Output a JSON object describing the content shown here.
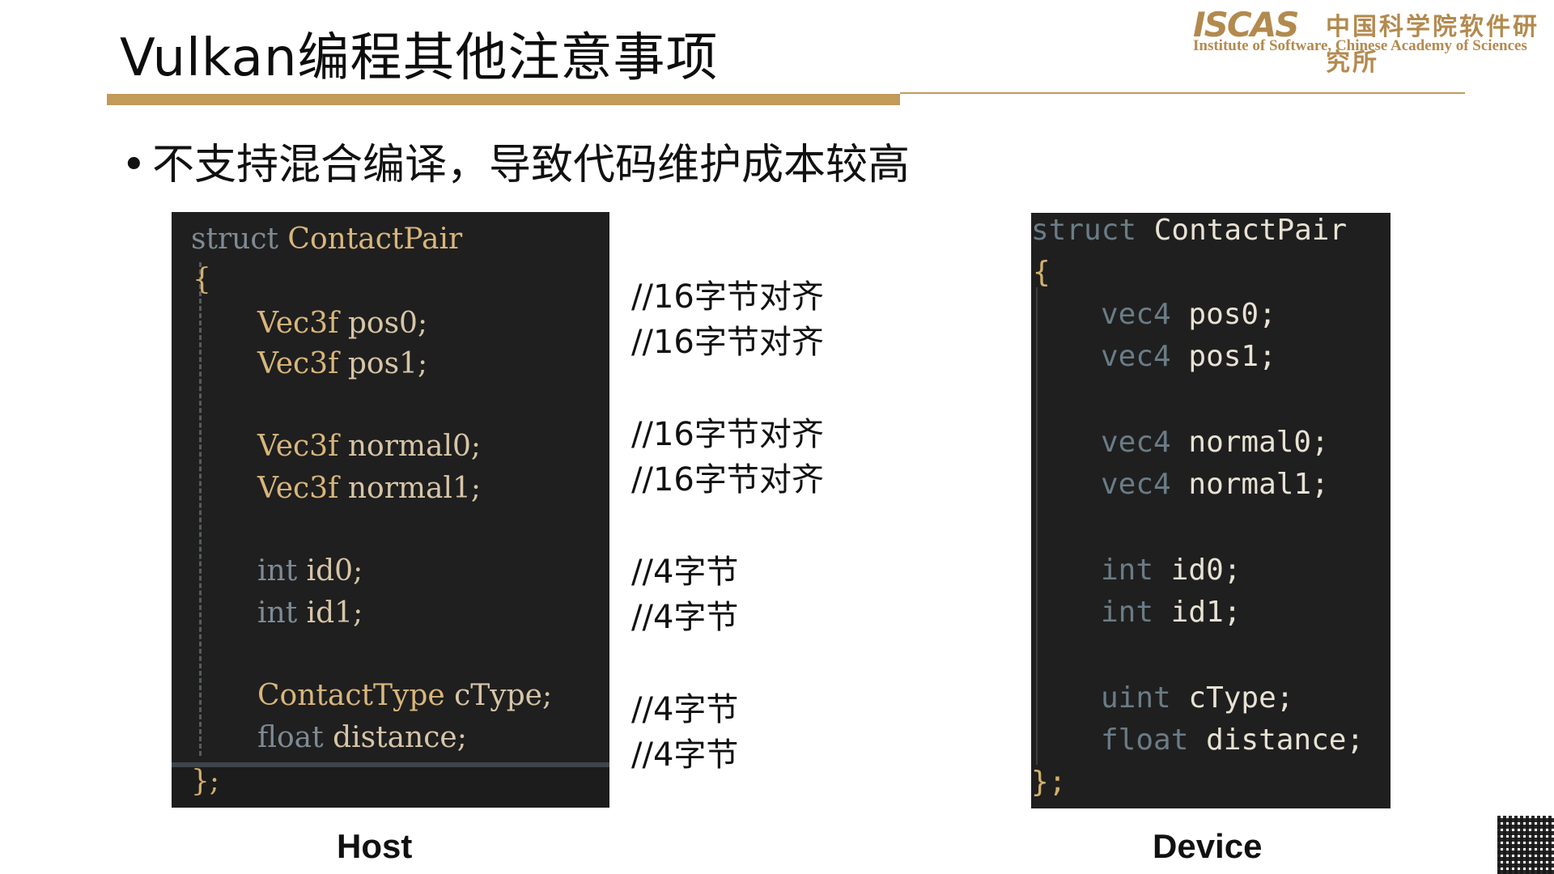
{
  "header": {
    "title": "Vulkan编程其他注意事项",
    "logo_mark": "ISCAS",
    "logo_cn": "中国科学院软件研究所",
    "logo_en": "Institute of Software, Chinese Academy of Sciences"
  },
  "bullet": {
    "symbol": "•",
    "text": "不支持混合编译，导致代码维护成本较高"
  },
  "host_code": {
    "line1_kw": "struct",
    "line1_name": "ContactPair",
    "open_brace": "{",
    "rows": [
      {
        "type": "Vec3f",
        "name": "pos0;"
      },
      {
        "type": "Vec3f",
        "name": "pos1;"
      },
      {
        "type": "Vec3f",
        "name": "normal0;"
      },
      {
        "type": "Vec3f",
        "name": "normal1;"
      },
      {
        "type": "int",
        "name": "id0;"
      },
      {
        "type": "int",
        "name": "id1;"
      },
      {
        "type": "ContactType",
        "name": "cType;"
      },
      {
        "type": "float",
        "name": "distance;"
      }
    ],
    "close_brace": "};"
  },
  "device_code": {
    "line1_kw": "struct",
    "line1_name": "ContactPair",
    "open_brace": "{",
    "rows": [
      {
        "type": "vec4",
        "name": "pos0;"
      },
      {
        "type": "vec4",
        "name": "pos1;"
      },
      {
        "type": "vec4",
        "name": "normal0;"
      },
      {
        "type": "vec4",
        "name": "normal1;"
      },
      {
        "type": "int",
        "name": "id0;"
      },
      {
        "type": "int",
        "name": "id1;"
      },
      {
        "type": "uint",
        "name": "cType;"
      },
      {
        "type": "float",
        "name": "distance;"
      }
    ],
    "close_brace": "};"
  },
  "comments": [
    "//16字节对齐",
    "//16字节对齐",
    "//16字节对齐",
    "//16字节对齐",
    "//4字节",
    "//4字节",
    "//4字节",
    "//4字节"
  ],
  "captions": {
    "host": "Host",
    "device": "Device"
  }
}
